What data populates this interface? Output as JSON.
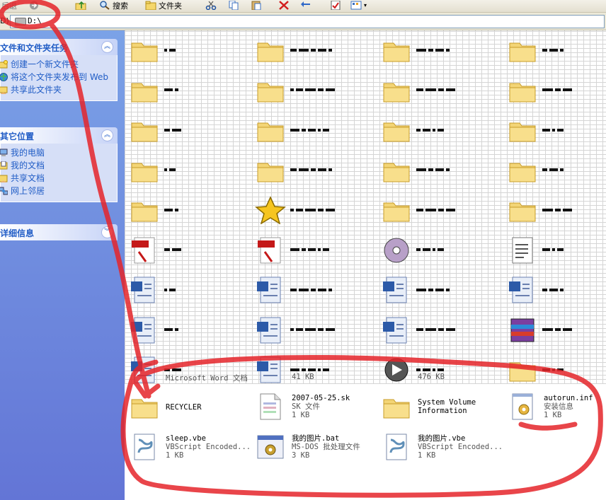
{
  "toolbar": {
    "back_label": "后退",
    "search_label": "搜索",
    "folders_label": "文件夹"
  },
  "address": {
    "label": "D)",
    "value": "D:\\"
  },
  "file_tasks": {
    "title": "文件和文件夹任务",
    "items": [
      {
        "label": "创建一个新文件夹",
        "icon": "new-folder-icon"
      },
      {
        "label": "将这个文件夹发布到 Web",
        "icon": "publish-web-icon"
      },
      {
        "label": "共享此文件夹",
        "icon": "share-folder-icon"
      }
    ]
  },
  "other_places": {
    "title": "其它位置",
    "items": [
      {
        "label": "我的电脑",
        "icon": "my-computer-icon"
      },
      {
        "label": "我的文档",
        "icon": "my-documents-icon"
      },
      {
        "label": "共享文档",
        "icon": "shared-documents-icon"
      },
      {
        "label": "网上邻居",
        "icon": "network-places-icon"
      }
    ]
  },
  "details": {
    "title": "详细信息"
  },
  "partial_labels": {
    "word_doc": "Microsoft Word 文档",
    "size_41": "41 KB",
    "size_476": "476 KB"
  },
  "files": [
    {
      "name": "RECYCLER",
      "type": "",
      "size": "",
      "icon": "folder-icon"
    },
    {
      "name": "2007-05-25.sk",
      "type": "SK 文件",
      "size": "1 KB",
      "icon": "generic-file-icon"
    },
    {
      "name": "System Volume",
      "type": "Information",
      "size": "",
      "icon": "folder-icon"
    },
    {
      "name": "autorun.inf",
      "type": "安装信息",
      "size": "1 KB",
      "icon": "setup-info-icon"
    },
    {
      "name": "sleep.vbe",
      "type": "VBScript Encoded...",
      "size": "1 KB",
      "icon": "vbscript-icon"
    },
    {
      "name": "我的图片.bat",
      "type": "MS-DOS 批处理文件",
      "size": "3 KB",
      "icon": "batch-file-icon"
    },
    {
      "name": "我的图片.vbe",
      "type": "VBScript Encoded...",
      "size": "1 KB",
      "icon": "vbscript-icon"
    }
  ],
  "colors": {
    "pane_blue": "#6f8fe0",
    "task_link": "#215dc6",
    "annotation_red": "#e5252a"
  }
}
